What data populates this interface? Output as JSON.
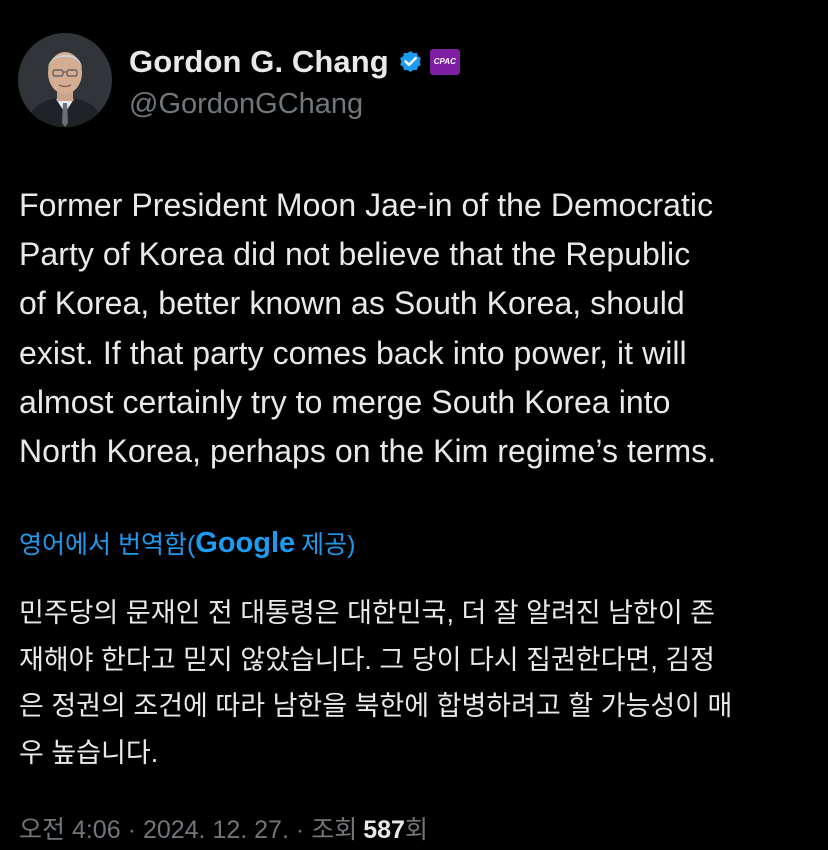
{
  "author": {
    "display_name": "Gordon G. Chang",
    "handle": "@GordonGChang",
    "verified_icon": "verified-badge-icon",
    "affiliate_badge_text": "CPAC",
    "avatar": "profile-photo"
  },
  "tweet": {
    "lines": [
      "Former President Moon Jae-in of the Democratic",
      "Party of Korea did not believe that the Republic",
      "of Korea, better known as South Korea, should",
      "exist. If that party comes back into power, it will",
      "almost certainly try to merge South Korea into",
      "North Korea, perhaps on the Kim regime’s terms."
    ]
  },
  "translation": {
    "prefix": "영어에서 번역함(",
    "provider": "Google",
    "suffix": "제공)",
    "lines": [
      "민주당의 문재인 전 대통령은 대한민국, 더 잘 알려진 남한이 존",
      "재해야 한다고 믿지 않았습니다. 그 당이 다시 집권한다면, 김정",
      "은 정권의 조건에 따라 남한을 북한에 합병하려고 할 가능성이 매",
      "우 높습니다."
    ]
  },
  "meta": {
    "time": "오전 4:06",
    "separator": "·",
    "date": "2024. 12. 27.",
    "views_label": "조회",
    "views_count": "587",
    "views_unit": "회"
  },
  "colors": {
    "background": "#000000",
    "text": "#e7e9ea",
    "secondary": "#71767b",
    "link": "#1d9bf0",
    "verified": "#1d9bf0"
  }
}
